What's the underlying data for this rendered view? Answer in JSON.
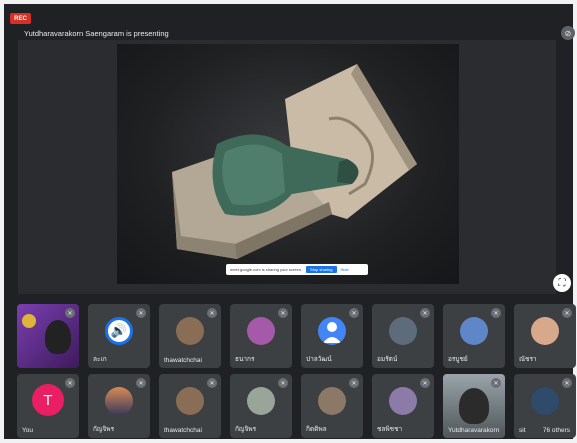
{
  "rec_badge": "REC",
  "presenter_text": "Yutdharavarakorn Saengaram is presenting",
  "share_bar": {
    "message": "meet.google.com is sharing your screen.",
    "stop_label": "Stop sharing",
    "hide_label": "Hide"
  },
  "icons": {
    "pin": "pin-icon",
    "mic_off": "mic-off-icon",
    "fullscreen": "fullscreen-icon",
    "speaker": "volume-icon",
    "person": "person-icon"
  },
  "participants": [
    {
      "name": ""
    },
    {
      "name": "ละเก"
    },
    {
      "name": "thawatchchai"
    },
    {
      "name": "ธนากร"
    },
    {
      "name": "ปาลวัฒน์"
    },
    {
      "name": "อมรัตน์"
    },
    {
      "name": "อรบูชย์"
    },
    {
      "name": "ณัชรา"
    },
    {
      "name": "You",
      "letter": "T"
    },
    {
      "name": "กัญจิพร"
    },
    {
      "name": "thawatchchai"
    },
    {
      "name": "กัญจิพร"
    },
    {
      "name": "กิตติพล"
    },
    {
      "name": "ชลพิชชา"
    },
    {
      "name": "Yutdharavarakorn"
    },
    {
      "name": "sit",
      "others": "76 others"
    }
  ]
}
